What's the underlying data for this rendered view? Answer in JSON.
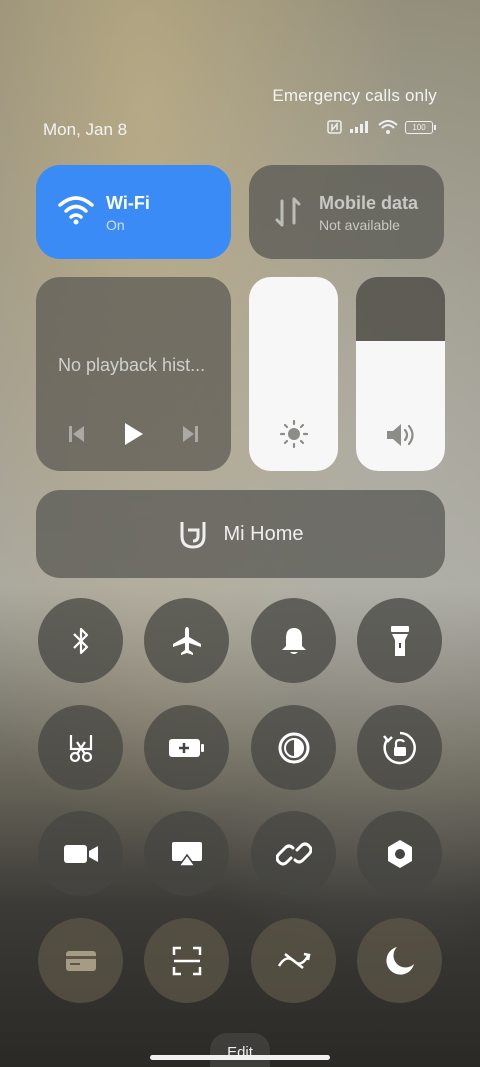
{
  "status": {
    "carrier_text": "Emergency calls only",
    "date": "Mon, Jan 8",
    "battery": "100",
    "icons": [
      "nfc-icon",
      "signal-icon",
      "wifi-signal-icon",
      "battery-icon"
    ]
  },
  "tiles": {
    "wifi": {
      "title": "Wi-Fi",
      "subtitle": "On",
      "color": "#3a8bf5"
    },
    "mobile_data": {
      "title": "Mobile data",
      "subtitle": "Not available"
    }
  },
  "media": {
    "title": "No playback hist...",
    "controls": [
      "previous-icon",
      "play-icon",
      "next-icon"
    ]
  },
  "sliders": {
    "brightness": {
      "icon": "brightness-icon",
      "level": 1.0
    },
    "volume": {
      "icon": "volume-icon",
      "level": 0.67
    }
  },
  "mi_home": {
    "label": "Mi Home"
  },
  "toggles": [
    "bluetooth-icon",
    "airplane-mode-icon",
    "ringer-icon",
    "flashlight-icon",
    "screenshot-icon",
    "battery-saver-icon",
    "dark-mode-icon",
    "rotation-lock-icon",
    "screen-recorder-icon",
    "cast-icon",
    "link-icon",
    "settings-icon",
    "card-icon",
    "scanner-icon",
    "auto-sync-icon",
    "do-not-disturb-icon"
  ],
  "footer": {
    "edit_label": "Edit"
  }
}
